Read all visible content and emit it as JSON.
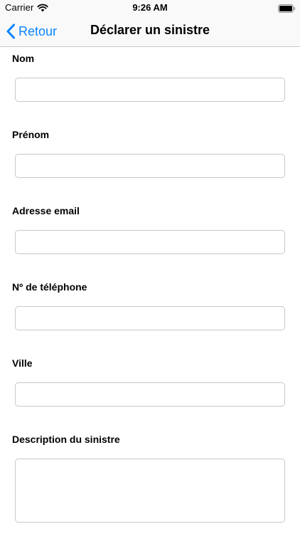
{
  "status_bar": {
    "carrier": "Carrier",
    "time": "9:26 AM",
    "icons": [
      "wifi-icon",
      "battery-icon"
    ]
  },
  "nav": {
    "back_label": "Retour",
    "back_icon": "chevron-left-icon",
    "title": "Déclarer un sinistre",
    "accent_color": "#0a84ff"
  },
  "form": {
    "fields": [
      {
        "label": "Nom",
        "value": "",
        "placeholder": ""
      },
      {
        "label": "Prénom",
        "value": "",
        "placeholder": ""
      },
      {
        "label": "Adresse email",
        "value": "",
        "placeholder": ""
      },
      {
        "label": "Nº de téléphone",
        "value": "",
        "placeholder": ""
      },
      {
        "label": "Ville",
        "value": "",
        "placeholder": ""
      },
      {
        "label": "Description du sinistre",
        "value": "",
        "placeholder": ""
      }
    ]
  }
}
